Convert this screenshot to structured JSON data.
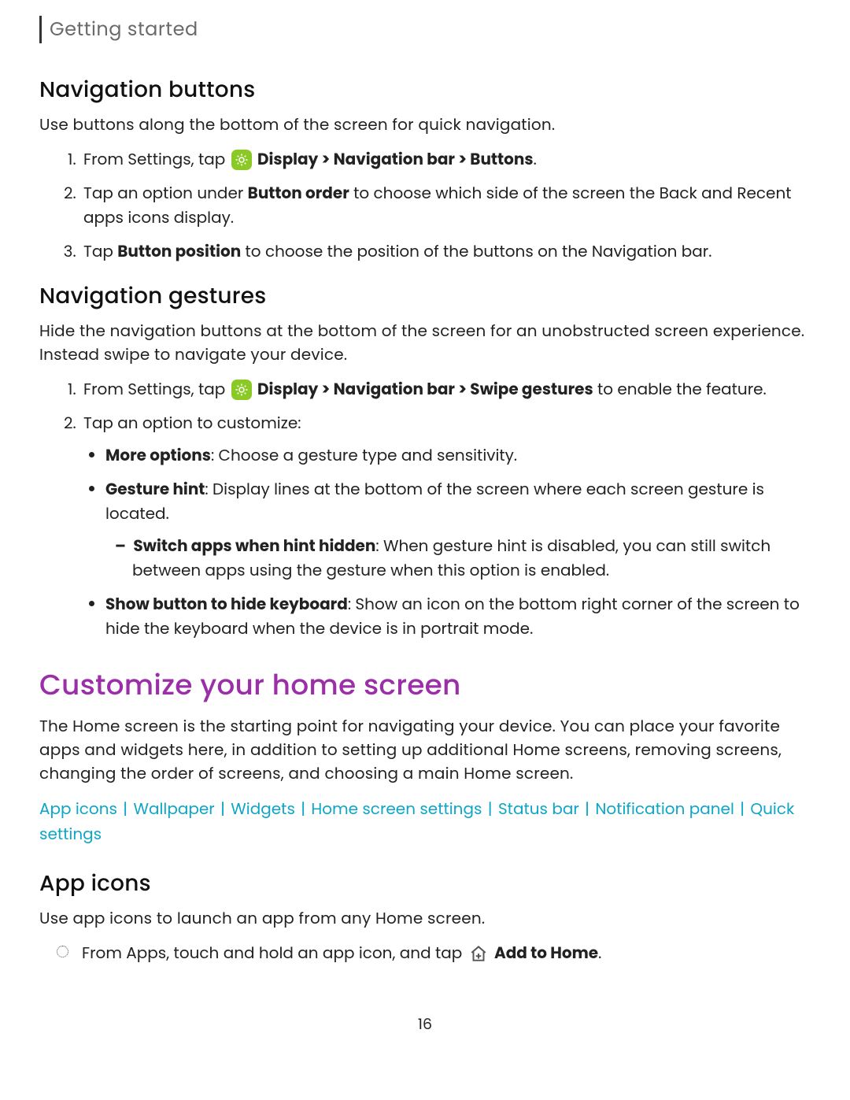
{
  "breadcrumb": "Getting started",
  "nav_buttons": {
    "heading": "Navigation buttons",
    "intro": "Use buttons along the bottom of the screen for quick navigation.",
    "step1_pre": "From Settings, tap ",
    "step1_bold": "Display > Navigation bar > Buttons",
    "step1_post": ".",
    "step2_pre": "Tap an option under ",
    "step2_bold": "Button order",
    "step2_post": " to choose which side of the screen the Back and Recent apps icons display.",
    "step3_pre": "Tap ",
    "step3_bold": "Button position",
    "step3_post": " to choose the position of the buttons on the Navigation bar."
  },
  "nav_gestures": {
    "heading": "Navigation gestures",
    "intro": "Hide the navigation buttons at the bottom of the screen for an unobstructed screen experience. Instead swipe to navigate your device.",
    "step1_pre": "From Settings, tap ",
    "step1_bold": "Display > Navigation bar > Swipe gestures",
    "step1_post": " to enable the feature.",
    "step2": "Tap an option to customize:",
    "more_options_bold": "More options",
    "more_options_rest": ": Choose a gesture type and sensitivity.",
    "gesture_hint_bold": "Gesture hint",
    "gesture_hint_rest": ": Display lines at the bottom of the screen where each screen gesture is located.",
    "switch_apps_bold": "Switch apps when hint hidden",
    "switch_apps_rest": ": When gesture hint is disabled, you can still switch between apps using the gesture when this option is enabled.",
    "show_button_bold": "Show button to hide keyboard",
    "show_button_rest": ": Show an icon on the bottom right corner of the screen to hide the keyboard when the device is in portrait mode."
  },
  "customize": {
    "heading": "Customize your home screen",
    "intro": "The Home screen is the starting point for navigating your device. You can place your favorite apps and widgets here, in addition to setting up additional Home screens, removing screens, changing the order of screens, and choosing a main Home screen.",
    "links": {
      "app_icons": "App icons",
      "wallpaper": "Wallpaper",
      "widgets": "Widgets",
      "home_screen_settings": "Home screen settings",
      "status_bar": "Status bar",
      "notification_panel": "Notification panel",
      "quick_settings": "Quick settings"
    }
  },
  "app_icons": {
    "heading": "App icons",
    "intro": "Use app icons to launch an app from any Home screen.",
    "step_pre": "From Apps, touch and hold an app icon, and tap ",
    "step_bold": "Add to Home",
    "step_post": "."
  },
  "page_number": "16"
}
